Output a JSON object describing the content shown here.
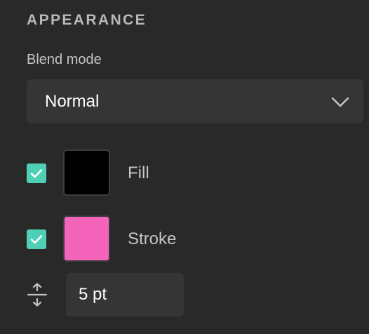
{
  "section": {
    "title": "APPEARANCE"
  },
  "blend_mode": {
    "label": "Blend mode",
    "value": "Normal",
    "icon": "chevron-down-icon"
  },
  "fill": {
    "checked": true,
    "color": "#000000",
    "label": "Fill"
  },
  "stroke": {
    "checked": true,
    "color": "#f464bb",
    "label": "Stroke"
  },
  "stroke_width": {
    "icon": "stroke-width-icon",
    "value": "5 pt"
  },
  "colors": {
    "accent": "#4fcfb5",
    "background": "#292929",
    "control": "#353535"
  }
}
